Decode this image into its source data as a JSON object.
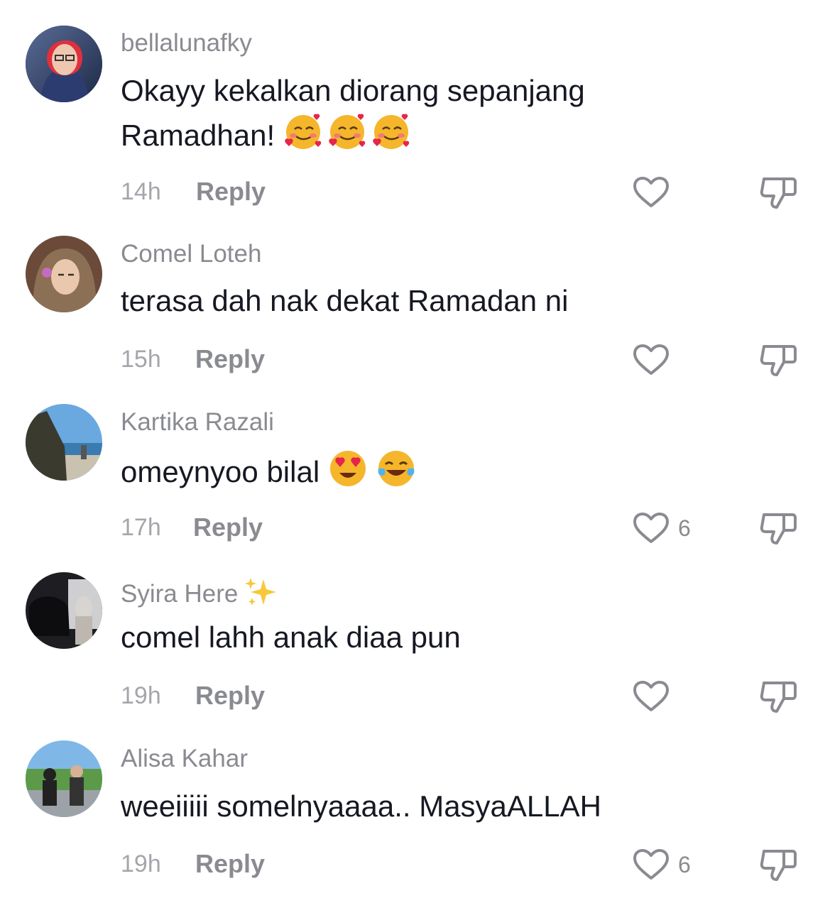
{
  "comments": [
    {
      "username": "bellalunafky",
      "text_line1": "Okayy kekalkan diorang sepanjang",
      "text_line2": "Ramadhan!",
      "emoji": "smiling-face-with-hearts x3",
      "time": "14h",
      "reply": "Reply",
      "likes": ""
    },
    {
      "username": "Comel Loteh",
      "text": "terasa dah nak dekat Ramadan ni",
      "time": "15h",
      "reply": "Reply",
      "likes": ""
    },
    {
      "username": "Kartika Razali",
      "text": "omeynyoo bilal",
      "emoji": "heart-eyes, tears-of-joy",
      "time": "17h",
      "reply": "Reply",
      "likes": "6"
    },
    {
      "username": "Syira Here",
      "username_emoji": "sparkles",
      "text": "comel lahh anak diaa pun",
      "time": "19h",
      "reply": "Reply",
      "likes": ""
    },
    {
      "username": "Alisa Kahar",
      "text": "weeiiiii somelnyaaaa.. MasyaALLAH",
      "time": "19h",
      "reply": "Reply",
      "likes": "6"
    }
  ],
  "colors": {
    "username": "#8a8b91",
    "text": "#161823",
    "meta": "#a5a6ab",
    "icon": "#8a8b91"
  }
}
